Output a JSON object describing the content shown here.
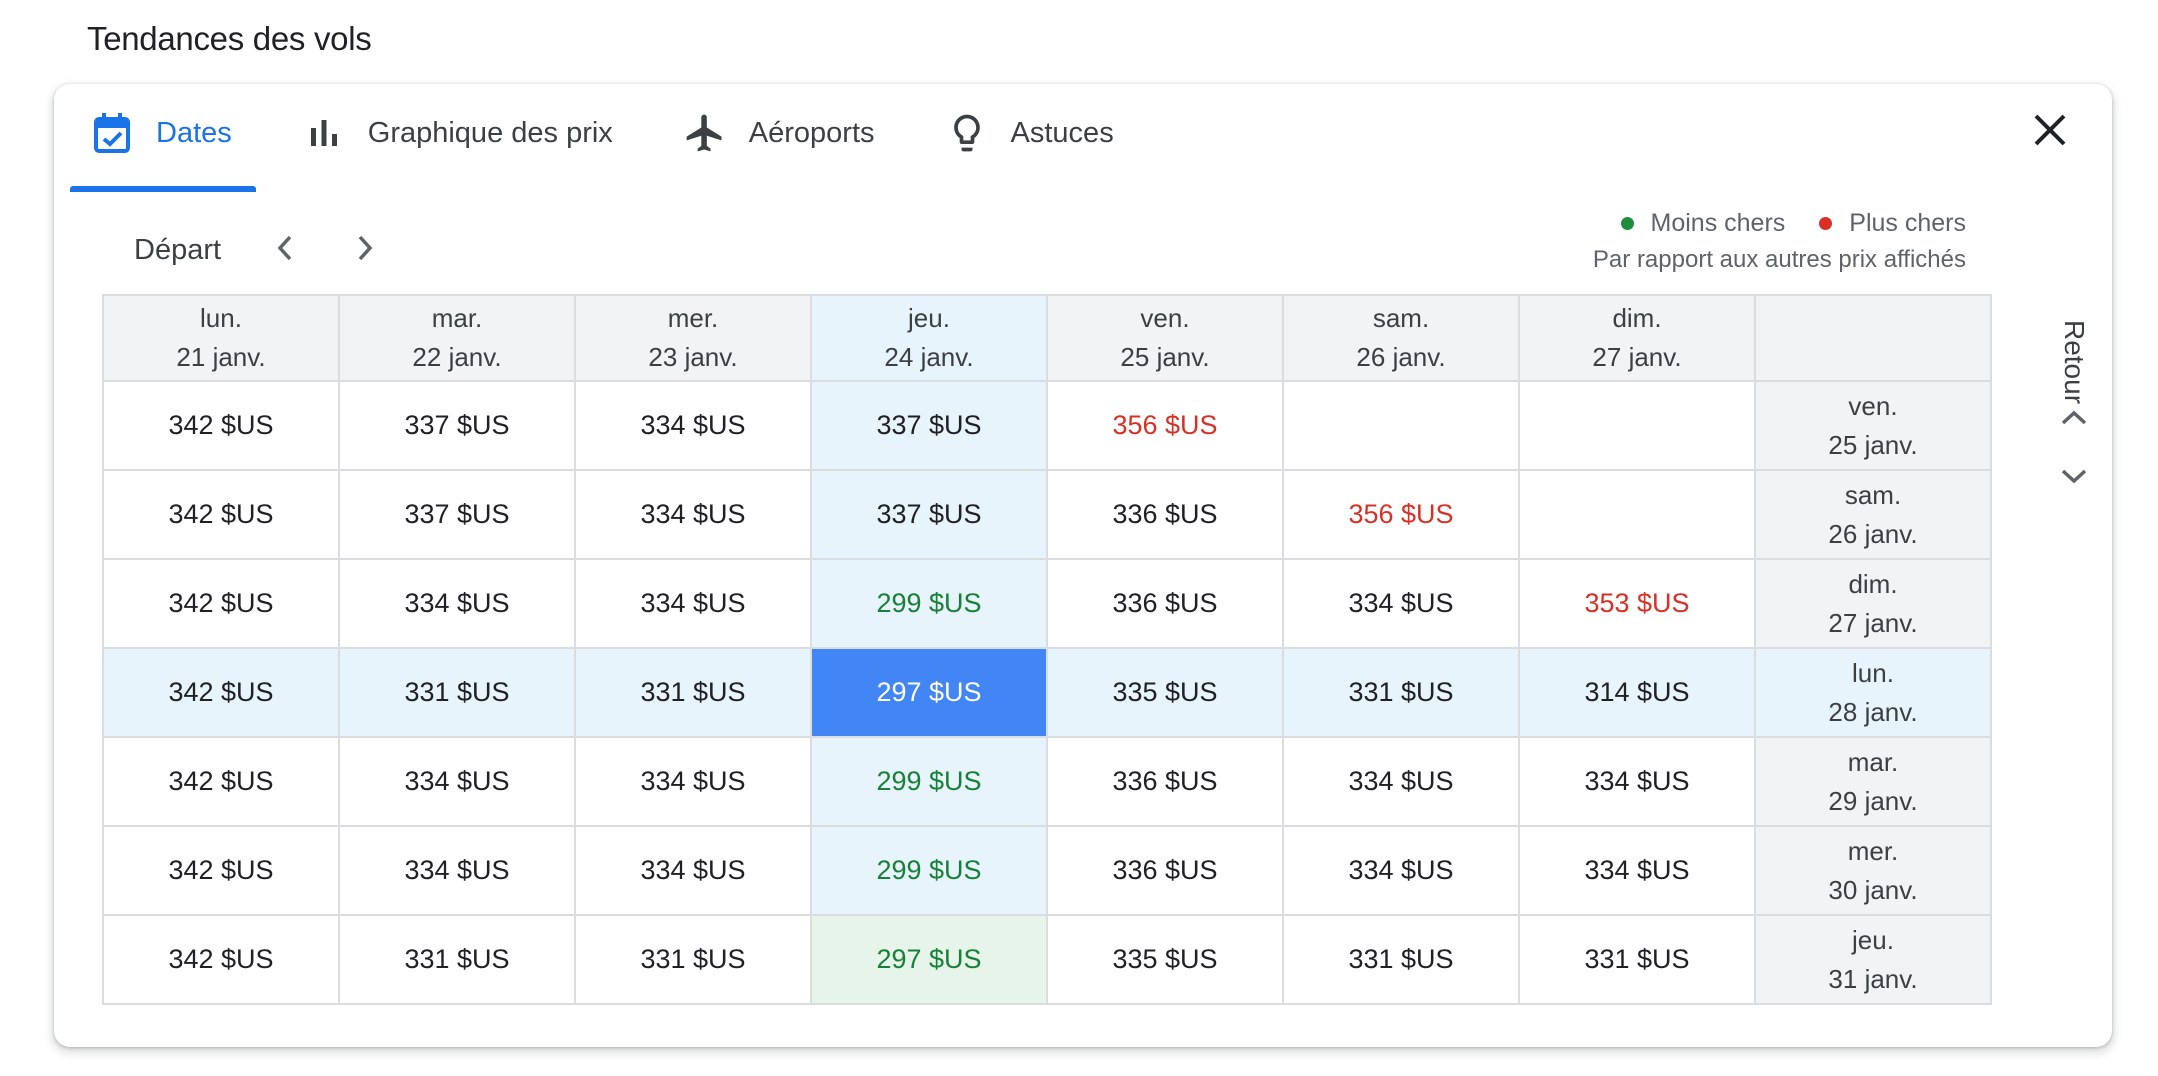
{
  "section_title": "Tendances des vols",
  "tabs": [
    {
      "label": "Dates",
      "icon": "calendar-check-icon",
      "active": true
    },
    {
      "label": "Graphique des prix",
      "icon": "bar-chart-icon",
      "active": false
    },
    {
      "label": "Aéroports",
      "icon": "airplane-icon",
      "active": false
    },
    {
      "label": "Astuces",
      "icon": "lightbulb-icon",
      "active": false
    }
  ],
  "close_icon": "close-icon",
  "depart": {
    "label": "Départ",
    "prev_icon": "chevron-left-icon",
    "next_icon": "chevron-right-icon"
  },
  "legend": {
    "cheap_label": "Moins chers",
    "expensive_label": "Plus chers",
    "note": "Par rapport aux autres prix affichés",
    "cheap_color": "#1e8e3e",
    "expensive_color": "#d93025"
  },
  "colors": {
    "accent": "#1a73e8",
    "selected": "#4285f4",
    "highlight": "#e8f4fc",
    "low_price": "#188038",
    "high_price": "#d93025"
  },
  "columns": [
    {
      "day": "lun.",
      "date": "21 janv."
    },
    {
      "day": "mar.",
      "date": "22 janv."
    },
    {
      "day": "mer.",
      "date": "23 janv."
    },
    {
      "day": "jeu.",
      "date": "24 janv."
    },
    {
      "day": "ven.",
      "date": "25 janv."
    },
    {
      "day": "sam.",
      "date": "26 janv."
    },
    {
      "day": "dim.",
      "date": "27 janv."
    }
  ],
  "rows": [
    {
      "day": "ven.",
      "date": "25 janv.",
      "prices": [
        "342 $US",
        "337 $US",
        "334 $US",
        "337 $US",
        "356 $US",
        "",
        ""
      ]
    },
    {
      "day": "sam.",
      "date": "26 janv.",
      "prices": [
        "342 $US",
        "337 $US",
        "334 $US",
        "337 $US",
        "336 $US",
        "356 $US",
        ""
      ]
    },
    {
      "day": "dim.",
      "date": "27 janv.",
      "prices": [
        "342 $US",
        "334 $US",
        "334 $US",
        "299 $US",
        "336 $US",
        "334 $US",
        "353 $US"
      ]
    },
    {
      "day": "lun.",
      "date": "28 janv.",
      "prices": [
        "342 $US",
        "331 $US",
        "331 $US",
        "297 $US",
        "335 $US",
        "331 $US",
        "314 $US"
      ]
    },
    {
      "day": "mar.",
      "date": "29 janv.",
      "prices": [
        "342 $US",
        "334 $US",
        "334 $US",
        "299 $US",
        "336 $US",
        "334 $US",
        "334 $US"
      ]
    },
    {
      "day": "mer.",
      "date": "30 janv.",
      "prices": [
        "342 $US",
        "334 $US",
        "334 $US",
        "299 $US",
        "336 $US",
        "334 $US",
        "334 $US"
      ]
    },
    {
      "day": "jeu.",
      "date": "31 janv.",
      "prices": [
        "342 $US",
        "331 $US",
        "331 $US",
        "297 $US",
        "335 $US",
        "331 $US",
        "331 $US"
      ]
    }
  ],
  "price_levels": {
    "low": [
      [
        2,
        3
      ],
      [
        4,
        3
      ],
      [
        5,
        3
      ],
      [
        6,
        3
      ]
    ],
    "high": [
      [
        0,
        4
      ],
      [
        1,
        5
      ],
      [
        2,
        6
      ]
    ]
  },
  "selected_cell": [
    3,
    3
  ],
  "retour": {
    "label": "Retour",
    "up_icon": "chevron-up-icon",
    "down_icon": "chevron-down-icon"
  }
}
